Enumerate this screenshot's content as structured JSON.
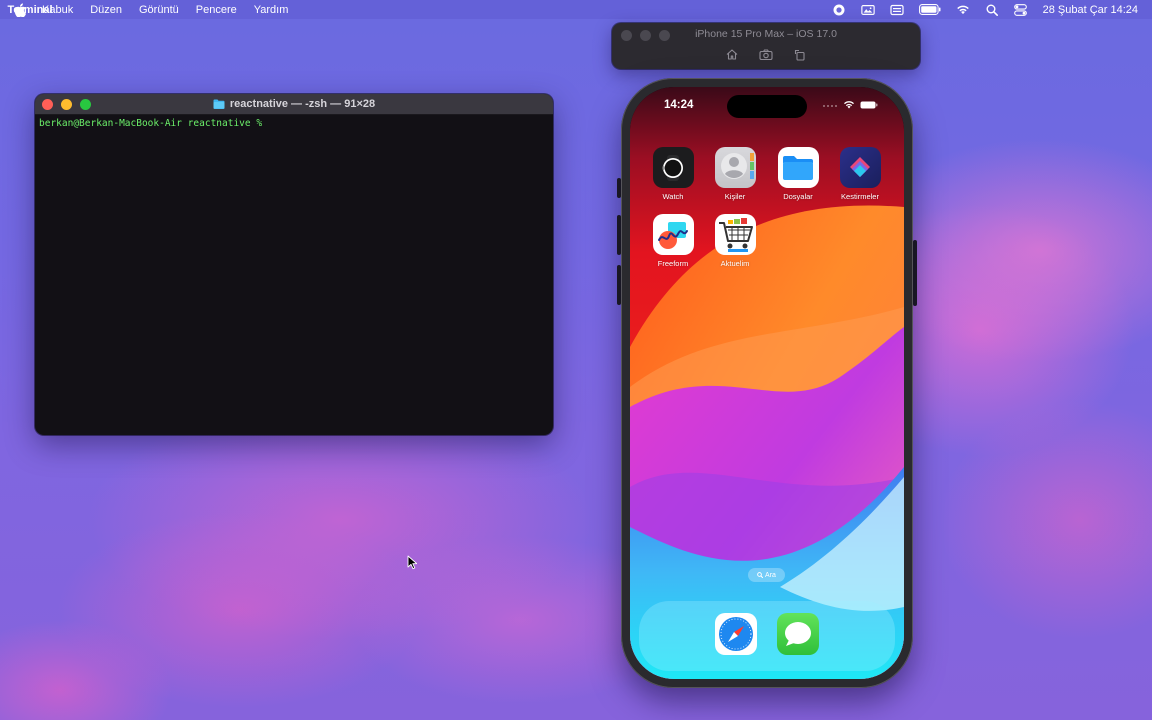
{
  "menubar": {
    "app_name": "Terminal",
    "items": [
      "Kabuk",
      "Düzen",
      "Görüntü",
      "Pencere",
      "Yardım"
    ],
    "clock": "28 Şubat Çar  14:24",
    "status_icons": [
      "screen-record-icon",
      "screen-mirror-icon",
      "keyboard-icon",
      "battery-icon",
      "wifi-icon",
      "spotlight-icon",
      "control-center-icon"
    ]
  },
  "terminal": {
    "title": "reactnative — -zsh — 91×28",
    "prompt": "berkan@Berkan-MacBook-Air reactnative %"
  },
  "simulator": {
    "title": "iPhone 15 Pro Max – iOS 17.0",
    "tools": [
      "home-icon",
      "screenshot-icon",
      "rotate-icon"
    ]
  },
  "phone": {
    "time": "14:24",
    "apps": [
      {
        "label": "Watch",
        "icon": "watch-icon"
      },
      {
        "label": "Kişiler",
        "icon": "contacts-icon"
      },
      {
        "label": "Dosyalar",
        "icon": "files-icon"
      },
      {
        "label": "Kestirmeler",
        "icon": "shortcuts-icon"
      },
      {
        "label": "Freeform",
        "icon": "freeform-icon"
      },
      {
        "label": "Aktuelim",
        "icon": "shopping-cart-icon"
      }
    ],
    "search_label": "Ara",
    "dock": [
      {
        "icon": "safari-icon"
      },
      {
        "icon": "messages-icon"
      }
    ]
  },
  "colors": {
    "terminal_text": "#6cf06a",
    "terminal_bg": "#121015",
    "close": "#fe5f57",
    "minimize": "#febc2e",
    "maximize": "#28c840"
  }
}
